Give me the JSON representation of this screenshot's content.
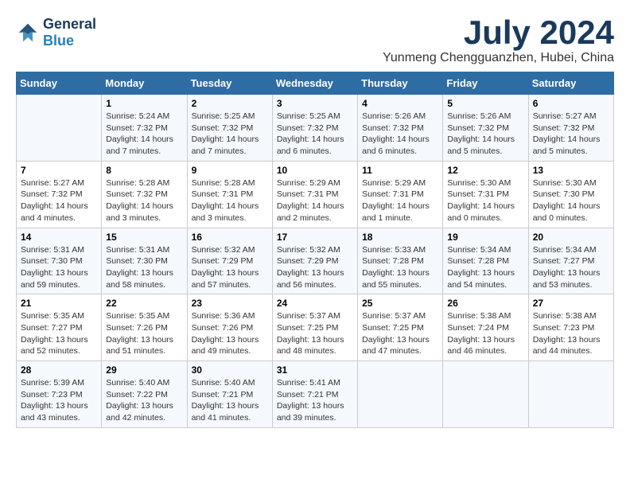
{
  "header": {
    "logo_line1": "General",
    "logo_line2": "Blue",
    "month": "July 2024",
    "location": "Yunmeng Chengguanzhen, Hubei, China"
  },
  "weekdays": [
    "Sunday",
    "Monday",
    "Tuesday",
    "Wednesday",
    "Thursday",
    "Friday",
    "Saturday"
  ],
  "weeks": [
    [
      {
        "day": "",
        "sunrise": "",
        "sunset": "",
        "daylight": ""
      },
      {
        "day": "1",
        "sunrise": "Sunrise: 5:24 AM",
        "sunset": "Sunset: 7:32 PM",
        "daylight": "Daylight: 14 hours and 7 minutes."
      },
      {
        "day": "2",
        "sunrise": "Sunrise: 5:25 AM",
        "sunset": "Sunset: 7:32 PM",
        "daylight": "Daylight: 14 hours and 7 minutes."
      },
      {
        "day": "3",
        "sunrise": "Sunrise: 5:25 AM",
        "sunset": "Sunset: 7:32 PM",
        "daylight": "Daylight: 14 hours and 6 minutes."
      },
      {
        "day": "4",
        "sunrise": "Sunrise: 5:26 AM",
        "sunset": "Sunset: 7:32 PM",
        "daylight": "Daylight: 14 hours and 6 minutes."
      },
      {
        "day": "5",
        "sunrise": "Sunrise: 5:26 AM",
        "sunset": "Sunset: 7:32 PM",
        "daylight": "Daylight: 14 hours and 5 minutes."
      },
      {
        "day": "6",
        "sunrise": "Sunrise: 5:27 AM",
        "sunset": "Sunset: 7:32 PM",
        "daylight": "Daylight: 14 hours and 5 minutes."
      }
    ],
    [
      {
        "day": "7",
        "sunrise": "Sunrise: 5:27 AM",
        "sunset": "Sunset: 7:32 PM",
        "daylight": "Daylight: 14 hours and 4 minutes."
      },
      {
        "day": "8",
        "sunrise": "Sunrise: 5:28 AM",
        "sunset": "Sunset: 7:32 PM",
        "daylight": "Daylight: 14 hours and 3 minutes."
      },
      {
        "day": "9",
        "sunrise": "Sunrise: 5:28 AM",
        "sunset": "Sunset: 7:31 PM",
        "daylight": "Daylight: 14 hours and 3 minutes."
      },
      {
        "day": "10",
        "sunrise": "Sunrise: 5:29 AM",
        "sunset": "Sunset: 7:31 PM",
        "daylight": "Daylight: 14 hours and 2 minutes."
      },
      {
        "day": "11",
        "sunrise": "Sunrise: 5:29 AM",
        "sunset": "Sunset: 7:31 PM",
        "daylight": "Daylight: 14 hours and 1 minute."
      },
      {
        "day": "12",
        "sunrise": "Sunrise: 5:30 AM",
        "sunset": "Sunset: 7:31 PM",
        "daylight": "Daylight: 14 hours and 0 minutes."
      },
      {
        "day": "13",
        "sunrise": "Sunrise: 5:30 AM",
        "sunset": "Sunset: 7:30 PM",
        "daylight": "Daylight: 14 hours and 0 minutes."
      }
    ],
    [
      {
        "day": "14",
        "sunrise": "Sunrise: 5:31 AM",
        "sunset": "Sunset: 7:30 PM",
        "daylight": "Daylight: 13 hours and 59 minutes."
      },
      {
        "day": "15",
        "sunrise": "Sunrise: 5:31 AM",
        "sunset": "Sunset: 7:30 PM",
        "daylight": "Daylight: 13 hours and 58 minutes."
      },
      {
        "day": "16",
        "sunrise": "Sunrise: 5:32 AM",
        "sunset": "Sunset: 7:29 PM",
        "daylight": "Daylight: 13 hours and 57 minutes."
      },
      {
        "day": "17",
        "sunrise": "Sunrise: 5:32 AM",
        "sunset": "Sunset: 7:29 PM",
        "daylight": "Daylight: 13 hours and 56 minutes."
      },
      {
        "day": "18",
        "sunrise": "Sunrise: 5:33 AM",
        "sunset": "Sunset: 7:28 PM",
        "daylight": "Daylight: 13 hours and 55 minutes."
      },
      {
        "day": "19",
        "sunrise": "Sunrise: 5:34 AM",
        "sunset": "Sunset: 7:28 PM",
        "daylight": "Daylight: 13 hours and 54 minutes."
      },
      {
        "day": "20",
        "sunrise": "Sunrise: 5:34 AM",
        "sunset": "Sunset: 7:27 PM",
        "daylight": "Daylight: 13 hours and 53 minutes."
      }
    ],
    [
      {
        "day": "21",
        "sunrise": "Sunrise: 5:35 AM",
        "sunset": "Sunset: 7:27 PM",
        "daylight": "Daylight: 13 hours and 52 minutes."
      },
      {
        "day": "22",
        "sunrise": "Sunrise: 5:35 AM",
        "sunset": "Sunset: 7:26 PM",
        "daylight": "Daylight: 13 hours and 51 minutes."
      },
      {
        "day": "23",
        "sunrise": "Sunrise: 5:36 AM",
        "sunset": "Sunset: 7:26 PM",
        "daylight": "Daylight: 13 hours and 49 minutes."
      },
      {
        "day": "24",
        "sunrise": "Sunrise: 5:37 AM",
        "sunset": "Sunset: 7:25 PM",
        "daylight": "Daylight: 13 hours and 48 minutes."
      },
      {
        "day": "25",
        "sunrise": "Sunrise: 5:37 AM",
        "sunset": "Sunset: 7:25 PM",
        "daylight": "Daylight: 13 hours and 47 minutes."
      },
      {
        "day": "26",
        "sunrise": "Sunrise: 5:38 AM",
        "sunset": "Sunset: 7:24 PM",
        "daylight": "Daylight: 13 hours and 46 minutes."
      },
      {
        "day": "27",
        "sunrise": "Sunrise: 5:38 AM",
        "sunset": "Sunset: 7:23 PM",
        "daylight": "Daylight: 13 hours and 44 minutes."
      }
    ],
    [
      {
        "day": "28",
        "sunrise": "Sunrise: 5:39 AM",
        "sunset": "Sunset: 7:23 PM",
        "daylight": "Daylight: 13 hours and 43 minutes."
      },
      {
        "day": "29",
        "sunrise": "Sunrise: 5:40 AM",
        "sunset": "Sunset: 7:22 PM",
        "daylight": "Daylight: 13 hours and 42 minutes."
      },
      {
        "day": "30",
        "sunrise": "Sunrise: 5:40 AM",
        "sunset": "Sunset: 7:21 PM",
        "daylight": "Daylight: 13 hours and 41 minutes."
      },
      {
        "day": "31",
        "sunrise": "Sunrise: 5:41 AM",
        "sunset": "Sunset: 7:21 PM",
        "daylight": "Daylight: 13 hours and 39 minutes."
      },
      {
        "day": "",
        "sunrise": "",
        "sunset": "",
        "daylight": ""
      },
      {
        "day": "",
        "sunrise": "",
        "sunset": "",
        "daylight": ""
      },
      {
        "day": "",
        "sunrise": "",
        "sunset": "",
        "daylight": ""
      }
    ]
  ]
}
